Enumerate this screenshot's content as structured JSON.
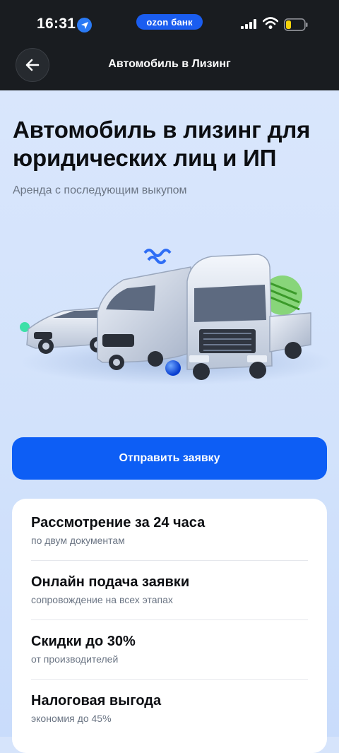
{
  "status_bar": {
    "time": "16:31",
    "badge": "ozon банк",
    "icons": [
      "location-arrow-icon",
      "cellular-signal-icon",
      "wifi-icon",
      "battery-icon"
    ],
    "badge_color": "#1a5df0"
  },
  "nav": {
    "title": "Автомобиль в Лизинг",
    "back_icon": "arrow-left-icon"
  },
  "hero": {
    "title": "Автомобиль в лизинг для юридических лиц и ИП",
    "subtitle": "Аренда с последующим выкупом",
    "illustration": "leasing-vehicles-illustration"
  },
  "cta": {
    "label": "Отправить заявку",
    "color": "#0d5ef5"
  },
  "benefits": [
    {
      "title": "Рассмотрение за 24 часа",
      "desc": "по двум документам"
    },
    {
      "title": "Онлайн подача заявки",
      "desc": "сопровождение на всех этапах"
    },
    {
      "title": "Скидки до 30%",
      "desc": "от производителей"
    },
    {
      "title": "Налоговая выгода",
      "desc": "экономия до 45%"
    }
  ]
}
